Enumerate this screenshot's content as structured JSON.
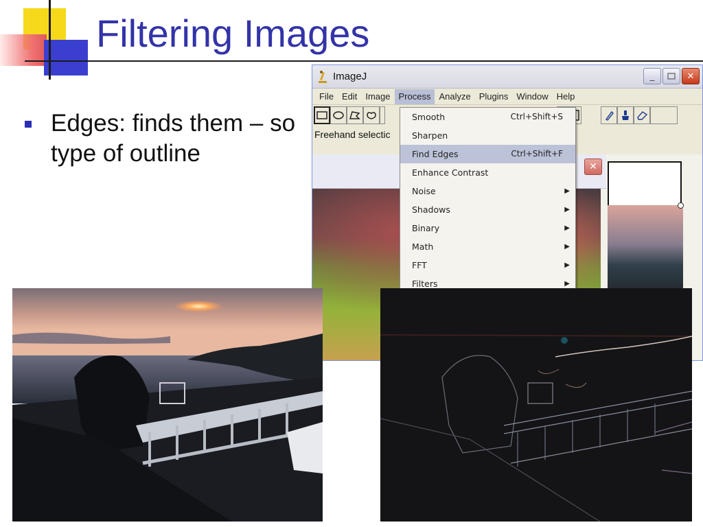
{
  "slide": {
    "title": "Filtering Images",
    "bullet": "Edges: finds them – so type of outline"
  },
  "imagej": {
    "window_title": "ImageJ",
    "menus": [
      "File",
      "Edit",
      "Image",
      "Process",
      "Analyze",
      "Plugins",
      "Window",
      "Help"
    ],
    "active_menu": "Process",
    "status_text": "Freehand selectic"
  },
  "process_menu": {
    "items": [
      {
        "label": "Smooth",
        "shortcut": "Ctrl+Shift+S",
        "submenu": false
      },
      {
        "label": "Sharpen",
        "shortcut": "",
        "submenu": false
      },
      {
        "label": "Find Edges",
        "shortcut": "Ctrl+Shift+F",
        "submenu": false,
        "highlighted": true
      },
      {
        "label": "Enhance Contrast",
        "shortcut": "",
        "submenu": false
      },
      {
        "label": "Noise",
        "shortcut": "",
        "submenu": true
      },
      {
        "label": "Shadows",
        "shortcut": "",
        "submenu": true
      },
      {
        "label": "Binary",
        "shortcut": "",
        "submenu": true
      },
      {
        "label": "Math",
        "shortcut": "",
        "submenu": true
      },
      {
        "label": "FFT",
        "shortcut": "",
        "submenu": true
      },
      {
        "label": "Filters",
        "shortcut": "",
        "submenu": true
      }
    ],
    "arrow_glyph": "▶"
  },
  "icons": {
    "minimize": "minimize-icon",
    "maximize": "maximize-icon",
    "close": "close-icon",
    "close_glyph": "✕",
    "minimize_glyph": "_"
  },
  "colors": {
    "title": "#3333a8",
    "highlight": "#bcc3d8",
    "bullet": "#2c2cb8"
  }
}
